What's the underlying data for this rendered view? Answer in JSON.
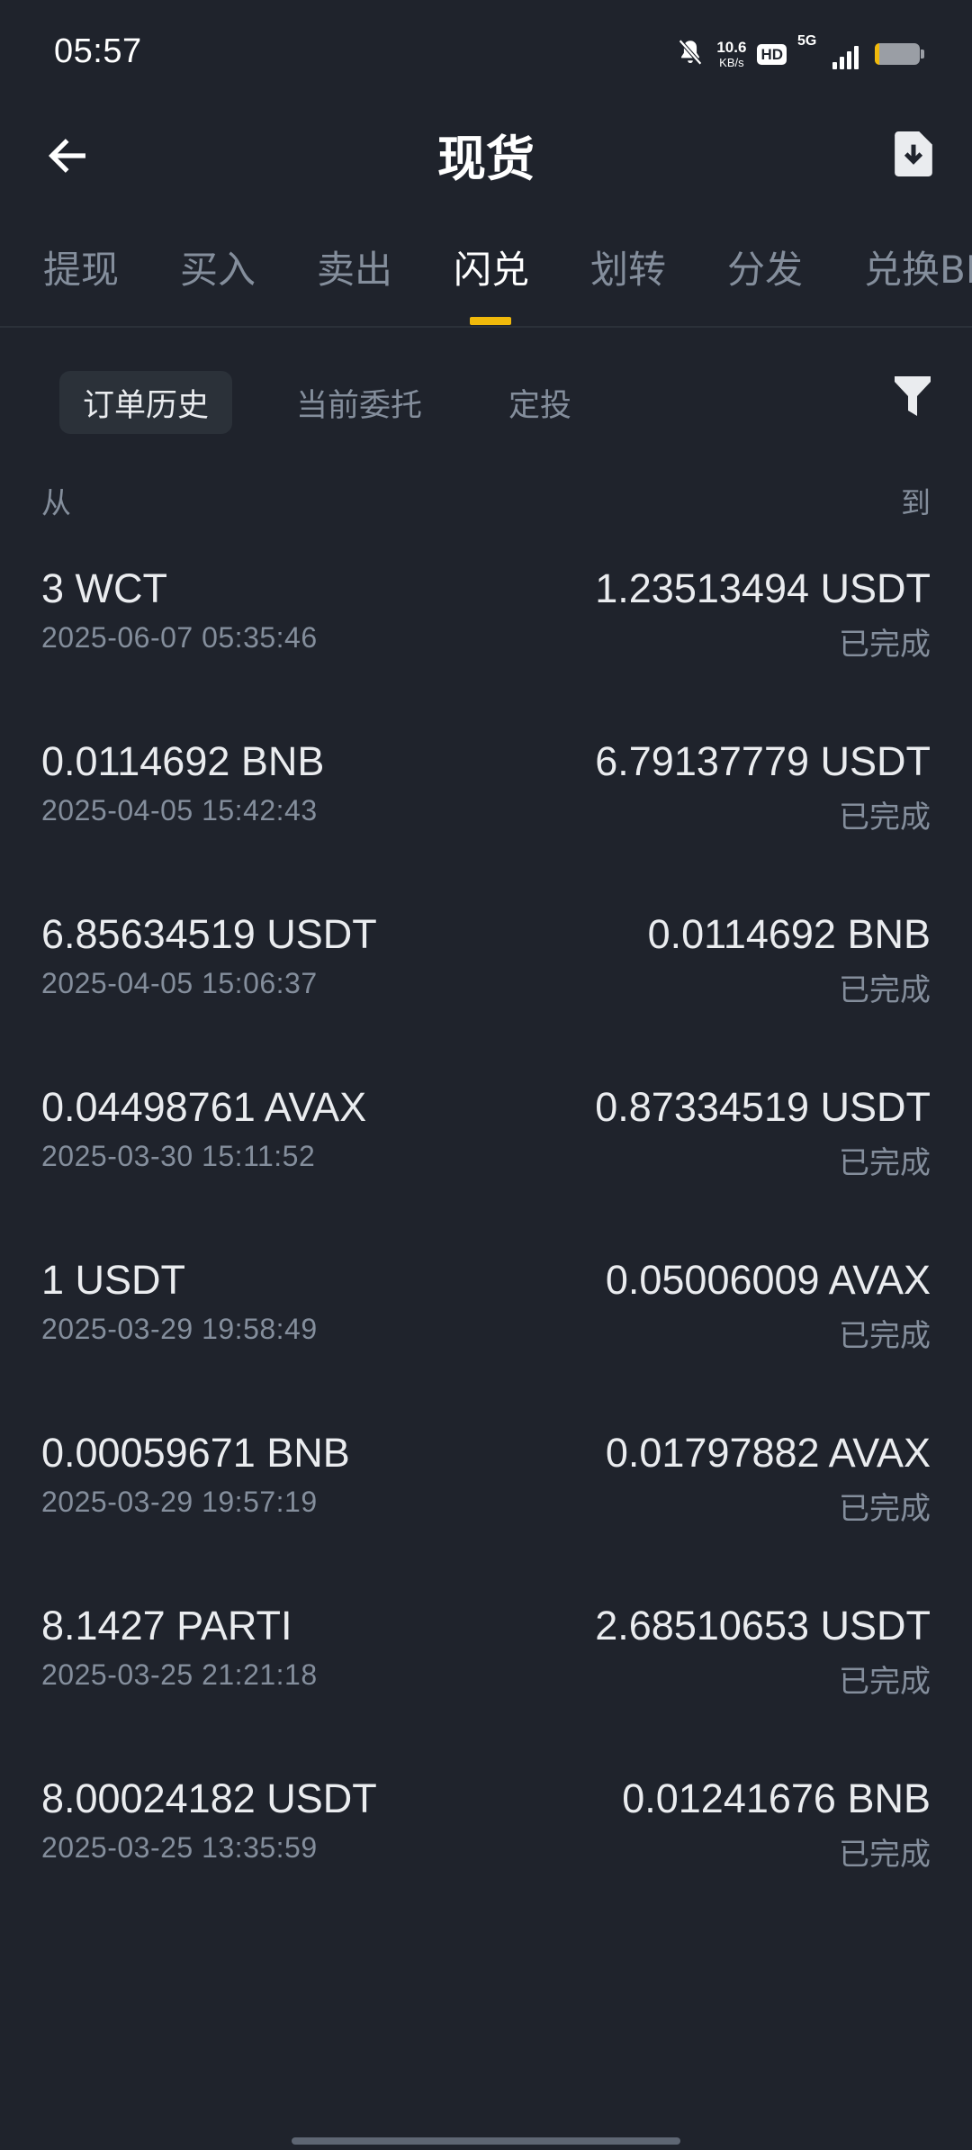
{
  "status_bar": {
    "time": "05:57",
    "net_speed_value": "10.6",
    "net_speed_unit": "KB/s",
    "hd_label": "HD",
    "network_label": "5G",
    "icons": [
      "mute-bell-icon",
      "hd-icon",
      "signal-icon",
      "battery-icon"
    ]
  },
  "header": {
    "title": "现货",
    "back_icon": "arrow-left-icon",
    "download_icon": "download-icon"
  },
  "tabs": [
    {
      "label": "提现",
      "active": false
    },
    {
      "label": "买入",
      "active": false
    },
    {
      "label": "卖出",
      "active": false
    },
    {
      "label": "闪兑",
      "active": true
    },
    {
      "label": "划转",
      "active": false
    },
    {
      "label": "分发",
      "active": false
    },
    {
      "label": "兑换BNB",
      "active": false
    }
  ],
  "subtabs": [
    {
      "label": "订单历史",
      "active": true
    },
    {
      "label": "当前委托",
      "active": false
    },
    {
      "label": "定投",
      "active": false
    }
  ],
  "filter_icon": "filter-icon",
  "columns": {
    "from": "从",
    "to": "到"
  },
  "orders": [
    {
      "from": "3 WCT",
      "time": "2025-06-07 05:35:46",
      "to": "1.23513494 USDT",
      "status": "已完成"
    },
    {
      "from": "0.0114692 BNB",
      "time": "2025-04-05 15:42:43",
      "to": "6.79137779 USDT",
      "status": "已完成"
    },
    {
      "from": "6.85634519 USDT",
      "time": "2025-04-05 15:06:37",
      "to": "0.0114692 BNB",
      "status": "已完成"
    },
    {
      "from": "0.04498761 AVAX",
      "time": "2025-03-30 15:11:52",
      "to": "0.87334519 USDT",
      "status": "已完成"
    },
    {
      "from": "1 USDT",
      "time": "2025-03-29 19:58:49",
      "to": "0.05006009 AVAX",
      "status": "已完成"
    },
    {
      "from": "0.00059671 BNB",
      "time": "2025-03-29 19:57:19",
      "to": "0.01797882 AVAX",
      "status": "已完成"
    },
    {
      "from": "8.1427 PARTI",
      "time": "2025-03-25 21:21:18",
      "to": "2.68510653 USDT",
      "status": "已完成"
    },
    {
      "from": "8.00024182 USDT",
      "time": "2025-03-25 13:35:59",
      "to": "0.01241676 BNB",
      "status": "已完成"
    }
  ],
  "colors": {
    "background": "#1f232c",
    "accent": "#f0b90b",
    "text_primary": "#eaecef",
    "text_secondary": "#848e9c"
  }
}
